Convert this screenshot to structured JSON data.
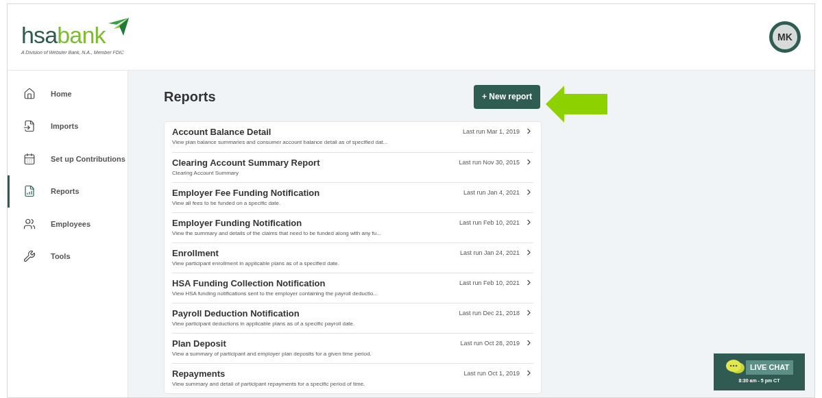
{
  "logo": {
    "part_1": "hsa",
    "part_2": "bank",
    "tagline": "A Division of Webster Bank, N.A., Member FDIC"
  },
  "user": {
    "initials": "MK"
  },
  "nav": [
    {
      "label": "Home",
      "selected": false
    },
    {
      "label": "Imports",
      "selected": false
    },
    {
      "label": "Set up Contributions",
      "selected": false
    },
    {
      "label": "Reports",
      "selected": true
    },
    {
      "label": "Employees",
      "selected": false
    },
    {
      "label": "Tools",
      "selected": false
    }
  ],
  "page": {
    "title": "Reports",
    "new_button": "+ New report"
  },
  "reports": [
    {
      "title": "Account Balance Detail",
      "description": "View plan balance summaries and consumer account balance detail as of specified dat...",
      "last_run": "Last run Mar 1, 2019"
    },
    {
      "title": "Clearing Account Summary Report",
      "description": "Clearing Account Summary",
      "last_run": "Last run Nov 30, 2015"
    },
    {
      "title": "Employer Fee Funding Notification",
      "description": "View all fees to be funded on a specific date.",
      "last_run": "Last run Jan 4, 2021"
    },
    {
      "title": "Employer Funding Notification",
      "description": "View the summary and details of the claims that need to be funded along with any fu...",
      "last_run": "Last run Feb 10, 2021"
    },
    {
      "title": "Enrollment",
      "description": "View participant enrollment in applicable plans as of a specified date.",
      "last_run": "Last run Jan 24, 2021"
    },
    {
      "title": "HSA Funding Collection Notification",
      "description": "View HSA funding notifications sent to the employer containing the payroll deductio...",
      "last_run": "Last run Feb 10, 2021"
    },
    {
      "title": "Payroll Deduction Notification",
      "description": "View participant deductions in applicable plans as of a specific payroll date.",
      "last_run": "Last run Dec 21, 2018"
    },
    {
      "title": "Plan Deposit",
      "description": "View a summary of participant and employer plan deposits for a given time period.",
      "last_run": "Last run Oct 28, 2019"
    },
    {
      "title": "Repayments",
      "description": "View summary and detail of participant repayments for a specific period of time.",
      "last_run": "Last run Oct 1, 2019"
    }
  ],
  "live_chat": {
    "label": "LIVE CHAT",
    "hours": "8:30 am - 5 pm CT"
  }
}
